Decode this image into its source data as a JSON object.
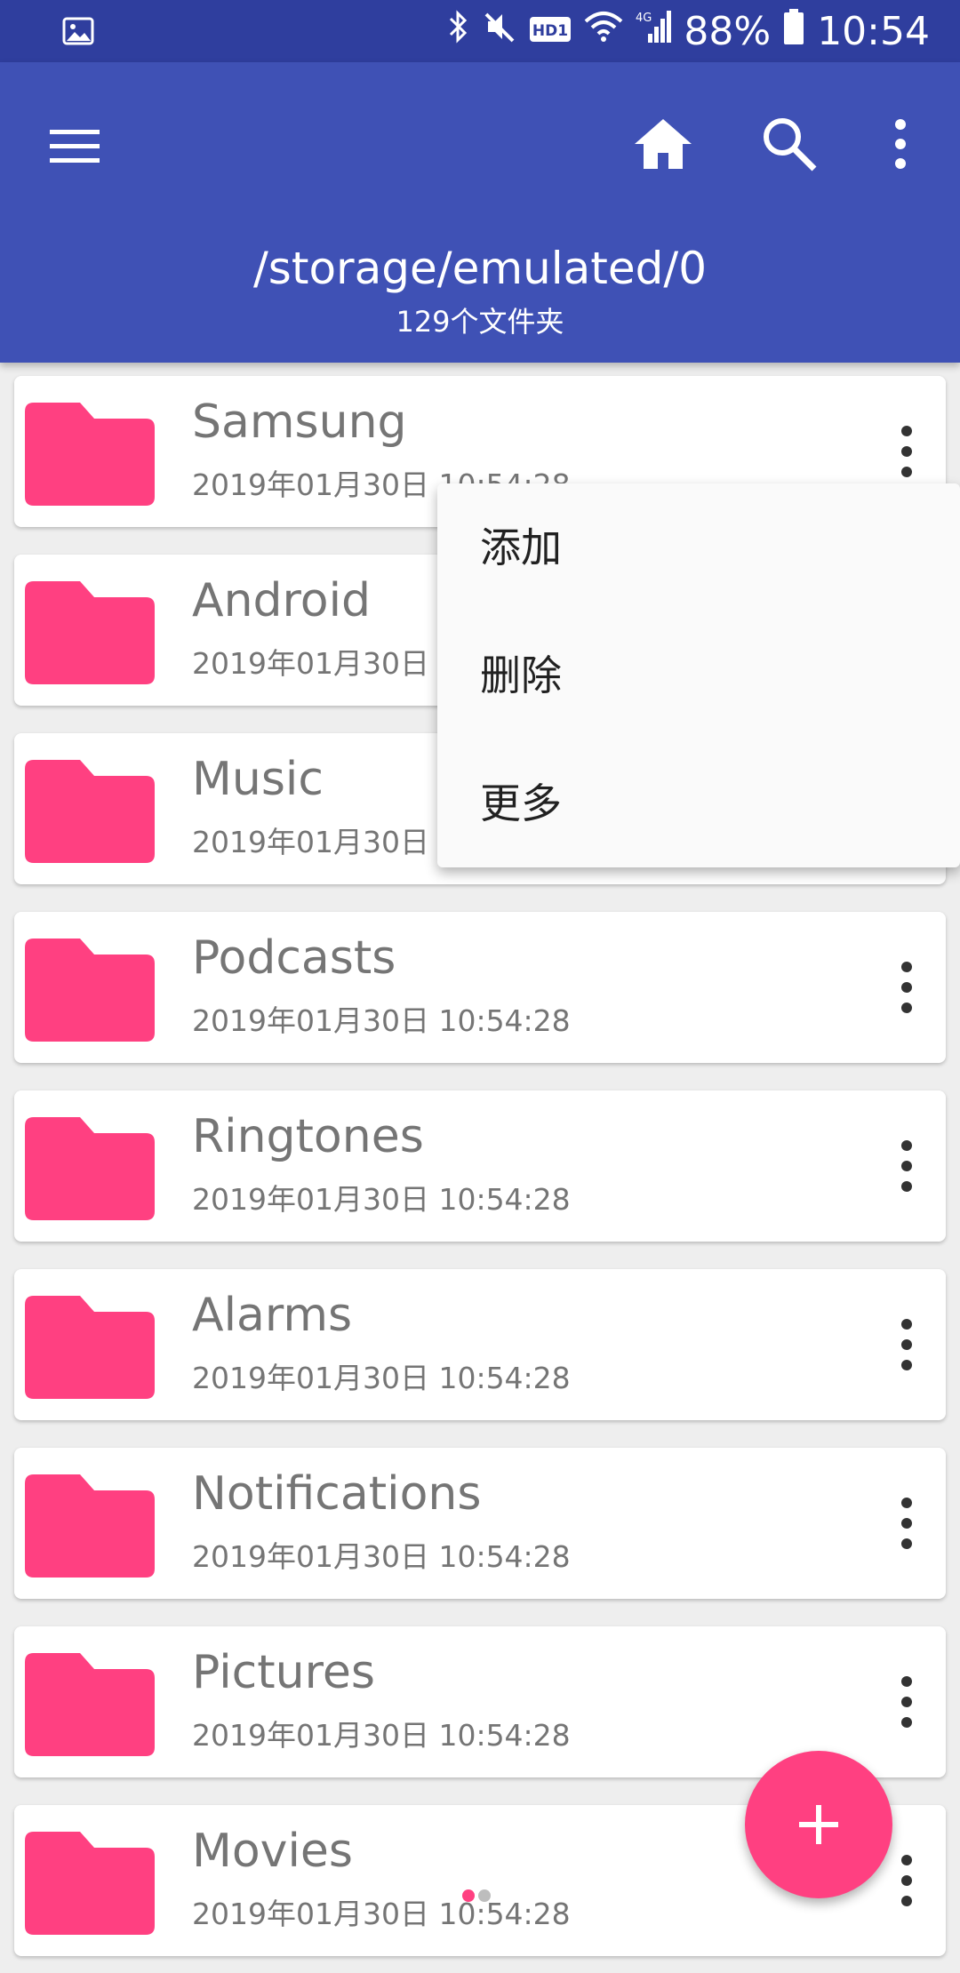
{
  "status_bar": {
    "battery": "88%",
    "time": "10:54",
    "network": "4G",
    "hd_badge": "HD1",
    "icons": [
      "image-notification-icon",
      "bluetooth-icon",
      "mute-icon",
      "hd-icon",
      "wifi-icon",
      "signal-icon",
      "battery-icon"
    ]
  },
  "app_bar": {
    "path": "/storage/emulated/0",
    "subtitle": "129个文件夹",
    "icons": [
      "menu-icon",
      "home-icon",
      "search-icon",
      "more-vert-icon"
    ]
  },
  "folders": [
    {
      "name": "Samsung",
      "date": "2019年01月30日 10:54:28"
    },
    {
      "name": "Android",
      "date": "2019年01月30日 1"
    },
    {
      "name": "Music",
      "date": "2019年01月30日 1"
    },
    {
      "name": "Podcasts",
      "date": "2019年01月30日 10:54:28"
    },
    {
      "name": "Ringtones",
      "date": "2019年01月30日 10:54:28"
    },
    {
      "name": "Alarms",
      "date": "2019年01月30日 10:54:28"
    },
    {
      "name": "Notifications",
      "date": "2019年01月30日 10:54:28"
    },
    {
      "name": "Pictures",
      "date": "2019年01月30日 10:54:28"
    },
    {
      "name": "Movies",
      "date": "2019年01月30日 10:54:28"
    }
  ],
  "popup_menu": {
    "items": [
      "添加",
      "删除",
      "更多"
    ]
  },
  "fab": {
    "icon": "plus-icon",
    "label": "+"
  },
  "colors": {
    "status_bar": "#2f3e9e",
    "primary": "#3f51b5",
    "accent": "#ff4081",
    "folder": "#ff4081",
    "text_secondary": "#757575"
  }
}
